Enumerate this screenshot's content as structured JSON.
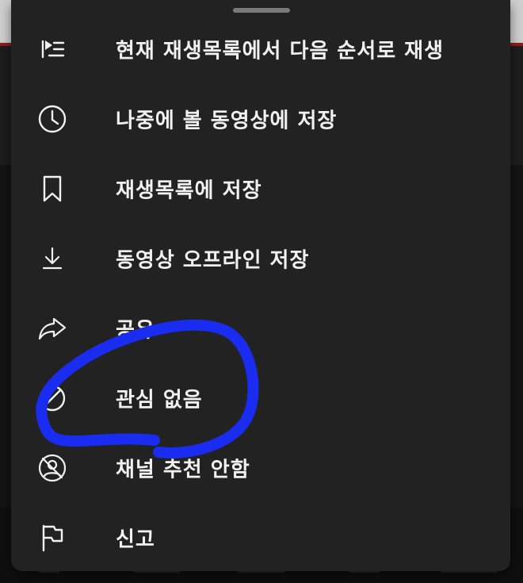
{
  "menu": {
    "items": [
      {
        "label": "현재 재생목록에서 다음 순서로 재생",
        "icon": "play-next-in-queue-icon"
      },
      {
        "label": "나중에 볼 동영상에 저장",
        "icon": "clock-icon"
      },
      {
        "label": "재생목록에 저장",
        "icon": "bookmark-icon"
      },
      {
        "label": "동영상 오프라인 저장",
        "icon": "download-icon"
      },
      {
        "label": "공유",
        "icon": "share-icon"
      },
      {
        "label": "관심 없음",
        "icon": "not-interested-icon"
      },
      {
        "label": "채널 추천 안함",
        "icon": "dont-recommend-channel-icon"
      },
      {
        "label": "신고",
        "icon": "flag-icon"
      }
    ]
  },
  "colors": {
    "sheet_background": "#222222",
    "text": "#f1f1f1",
    "annotation_stroke": "#1a2cf0"
  }
}
